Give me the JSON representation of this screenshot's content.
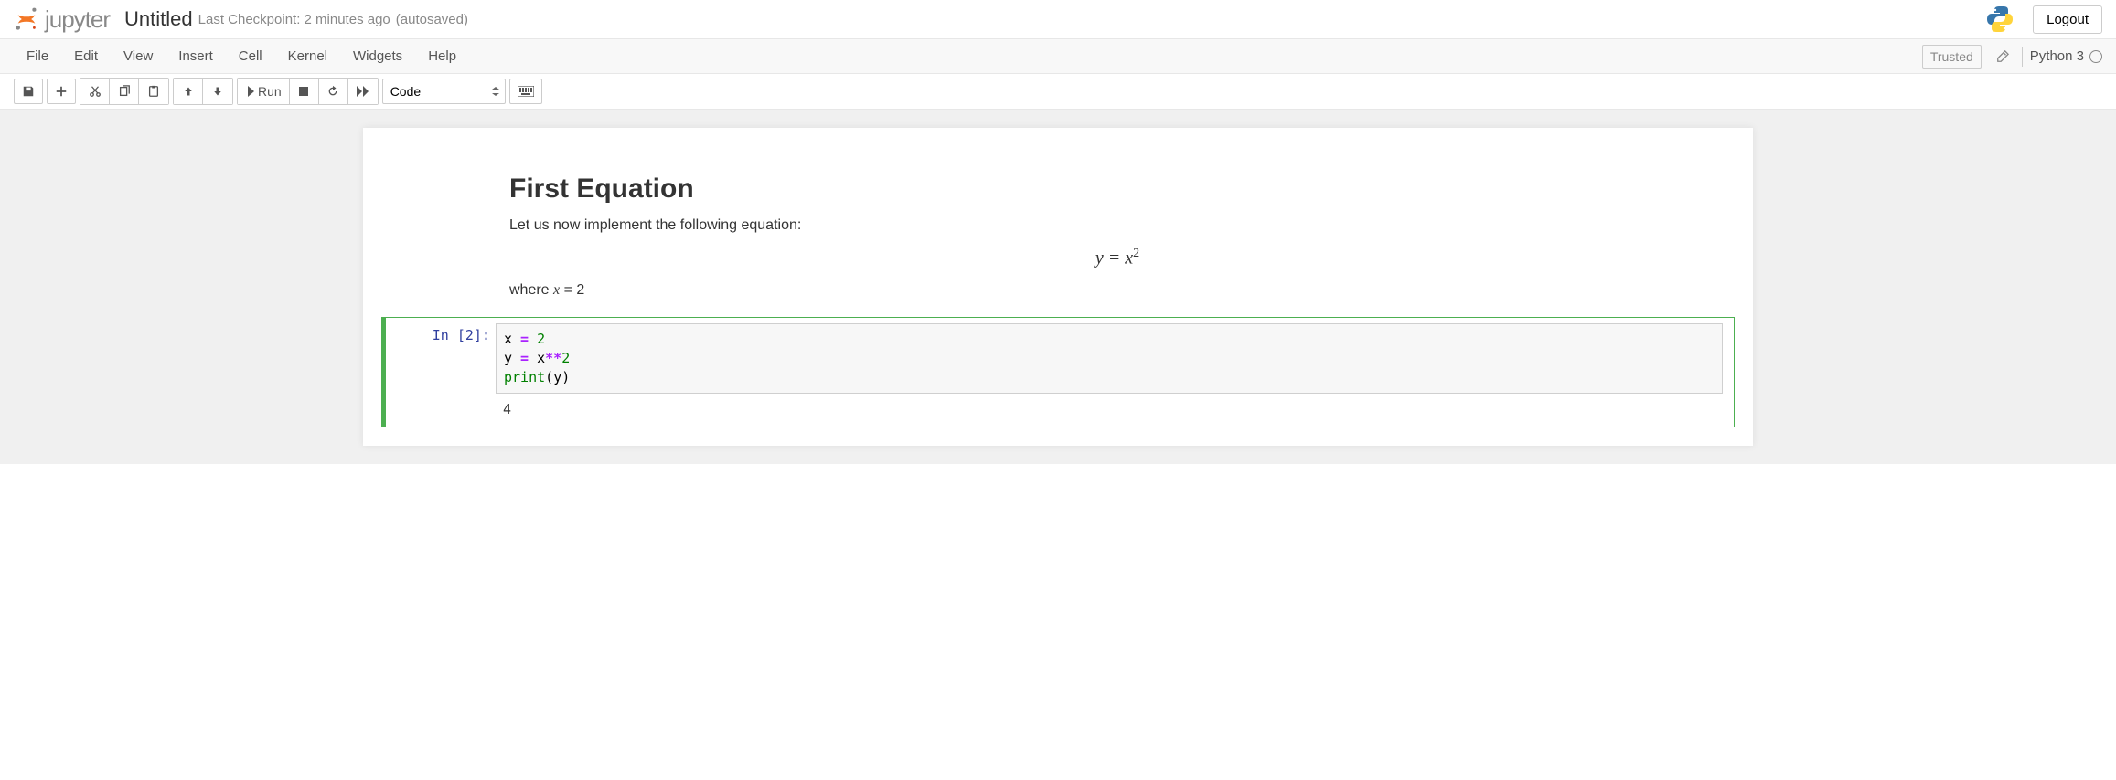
{
  "header": {
    "logo_text": "jupyter",
    "notebook_name": "Untitled",
    "checkpoint": "Last Checkpoint: 2 minutes ago",
    "autosave": "(autosaved)",
    "logout": "Logout"
  },
  "menubar": {
    "items": [
      "File",
      "Edit",
      "View",
      "Insert",
      "Cell",
      "Kernel",
      "Widgets",
      "Help"
    ],
    "trusted": "Trusted",
    "kernel": "Python 3"
  },
  "toolbar": {
    "run_label": "Run",
    "cell_type": "Code"
  },
  "cells": {
    "markdown": {
      "heading": "First Equation",
      "intro": "Let us now implement the following equation:",
      "equation_lhs": "y",
      "equation_eq": " = ",
      "equation_rhs_base": "x",
      "equation_rhs_exp": "2",
      "where_prefix": "where ",
      "where_var": "x",
      "where_eq": " = ",
      "where_val": "2"
    },
    "code": {
      "prompt": "In [2]:",
      "line1_var1": "x",
      "line1_op": " = ",
      "line1_num": "2",
      "line2_var1": "y",
      "line2_op": " = ",
      "line2_var2": "x",
      "line2_pow": "**",
      "line2_exp": "2",
      "line3_func": "print",
      "line3_open": "(",
      "line3_arg": "y",
      "line3_close": ")",
      "output": "4"
    }
  }
}
